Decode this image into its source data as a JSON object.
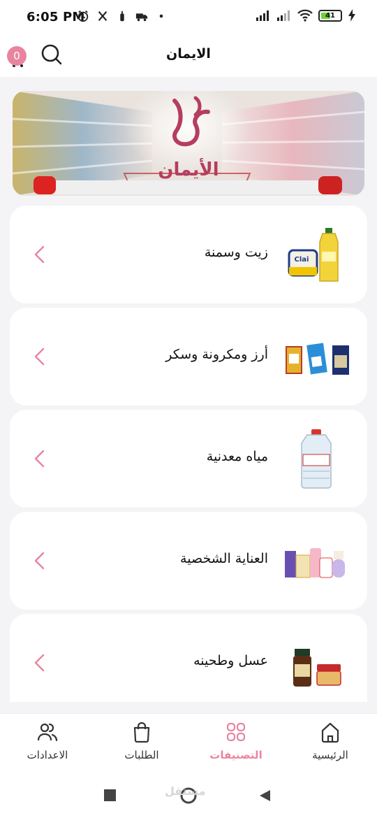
{
  "status_bar": {
    "time": "6:05 PM",
    "battery": "41",
    "battery_level": 0.41,
    "left_icons": [
      "alarm-icon",
      "restaurant-icon",
      "gift-icon",
      "truck-icon",
      "dot-icon"
    ],
    "right_icons": [
      "signal-icon",
      "signal-icon",
      "wifi-icon",
      "battery-icon",
      "charging-icon"
    ]
  },
  "app_bar": {
    "title": "الايمان",
    "cart_count": "0",
    "cart_icon": "cart-icon",
    "search_icon": "search-icon"
  },
  "banner": {
    "logo_text": "الأيمان",
    "image": "shopping-cart-in-supermarket-aisle"
  },
  "categories": [
    {
      "label": "زيت وسمنة",
      "image": "oil-and-ghee-products"
    },
    {
      "label": "أرز ومكرونة وسكر",
      "image": "rice-pasta-sugar-packs"
    },
    {
      "label": "مياه معدنية",
      "image": "mineral-water-bottle"
    },
    {
      "label": "العناية الشخصية",
      "image": "personal-care-products"
    },
    {
      "label": "عسل وطحينه",
      "image": "honey-and-tahini-jars"
    }
  ],
  "bottom_nav": {
    "items": [
      {
        "label": "الرئيسية",
        "icon": "home-icon",
        "active": false
      },
      {
        "label": "التصنيفات",
        "icon": "categories-icon",
        "active": true
      },
      {
        "label": "الطلبات",
        "icon": "shopping-bag-icon",
        "active": false
      },
      {
        "label": "الاعدادات",
        "icon": "users-icon",
        "active": false
      }
    ]
  },
  "system_nav": {
    "watermark": "مستقل",
    "buttons": [
      "recents-square-icon",
      "home-circle-icon",
      "back-triangle-icon"
    ]
  },
  "colors": {
    "accent": "#e9849f",
    "brand": "#b53d5f",
    "card_bg": "#ffffff",
    "page_bg": "#f4f4f6"
  }
}
